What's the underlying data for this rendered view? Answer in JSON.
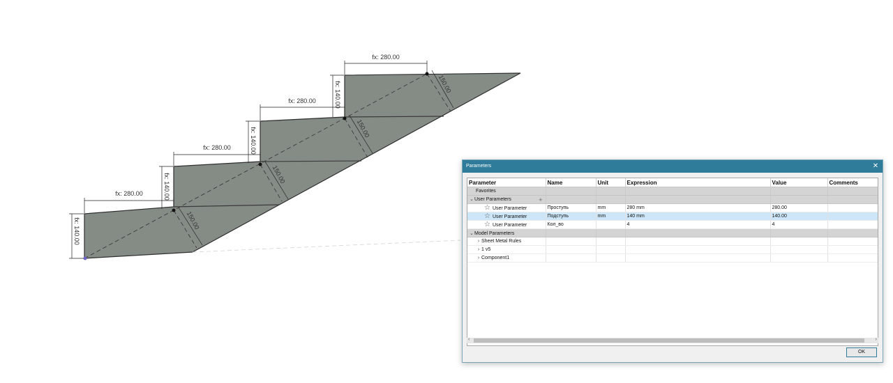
{
  "drawing": {
    "tread_dims": [
      "fx: 280.00",
      "fx: 280.00",
      "fx: 280.00",
      "fx: 280.00"
    ],
    "riser_dims": [
      "fx: 140.00",
      "fx: 140.00",
      "fx: 140.00",
      "fx: 140.00"
    ],
    "thickness_dims": [
      "150.00",
      "150.00",
      "150.00",
      "150.00"
    ]
  },
  "dialog": {
    "title": "Parameters",
    "columns": [
      "Parameter",
      "Name",
      "Unit",
      "Expression",
      "Value",
      "Comments"
    ],
    "favorites_label": "Favorites",
    "user_params_label": "User Parameters",
    "user_params": [
      {
        "param": "User Parameter",
        "name": "Проступь",
        "unit": "mm",
        "expression": "280 mm",
        "value": "280.00",
        "comments": ""
      },
      {
        "param": "User Parameter",
        "name": "Подступь",
        "unit": "mm",
        "expression": "140 mm",
        "value": "140.00",
        "comments": ""
      },
      {
        "param": "User Parameter",
        "name": "Кол_во",
        "unit": "",
        "expression": "4",
        "value": "4",
        "comments": ""
      }
    ],
    "model_params_label": "Model Parameters",
    "model_params": [
      "Sheet Metal Rules",
      "1 v5",
      "Component1"
    ],
    "ok_label": "OK"
  }
}
